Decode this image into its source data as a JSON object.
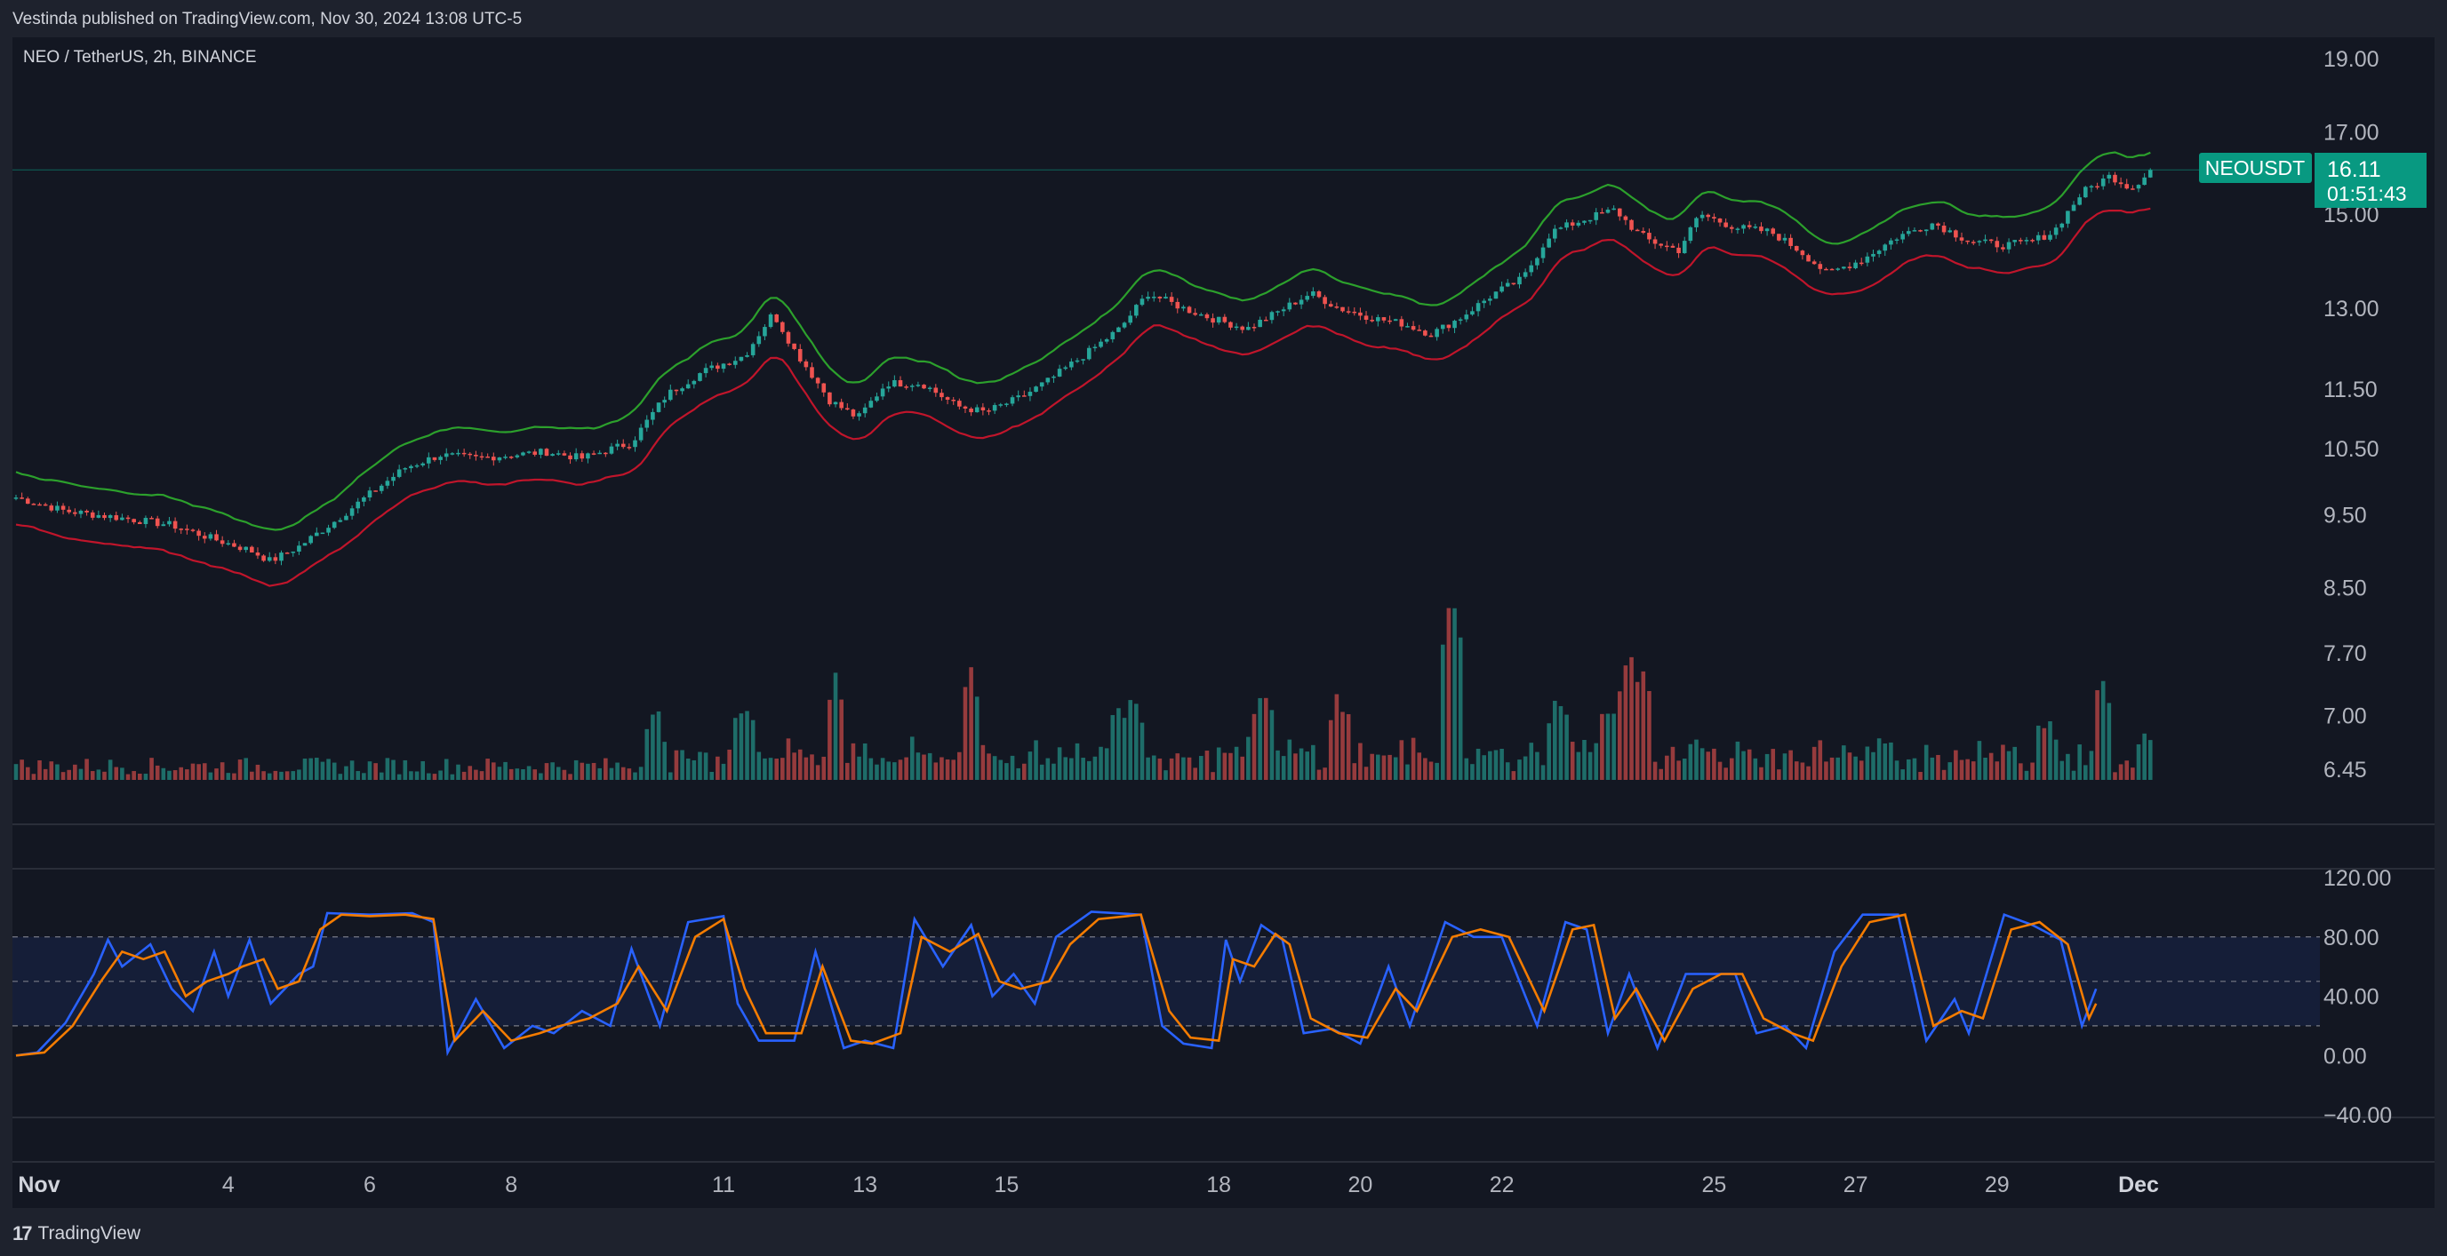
{
  "header": {
    "published": "Vestinda published on TradingView.com, Nov 30, 2024 13:08 UTC-5",
    "symbol_info": "NEO / TetherUS, 2h, BINANCE"
  },
  "footer": {
    "brand": "TradingView",
    "logo": "17"
  },
  "colors": {
    "background": "#131722",
    "bull": "#26a69a",
    "bear": "#ef5350",
    "upper_band": "#2ca02c",
    "lower_band": "#c0152b",
    "stoch_k": "#2962ff",
    "stoch_d": "#f57c00",
    "price_tag": "#089981"
  },
  "chart_data": [
    {
      "type": "candlestick",
      "series_name": "NEOUSDT",
      "y_scale": "log",
      "y_ticks": [
        "19.00",
        "17.00",
        "15.00",
        "13.00",
        "11.50",
        "10.50",
        "9.50",
        "8.50",
        "7.70",
        "7.00",
        "6.45"
      ],
      "last_price": "16.11",
      "countdown": "01:51:43",
      "x_ticks": [
        "Nov",
        "4",
        "6",
        "8",
        "11",
        "13",
        "15",
        "18",
        "20",
        "22",
        "25",
        "27",
        "29",
        "Dec"
      ],
      "x_tick_days": [
        1,
        4,
        6,
        8,
        11,
        13,
        15,
        18,
        20,
        22,
        25,
        27,
        29,
        31
      ],
      "close_path": [
        [
          1.0,
          9.75
        ],
        [
          1.7,
          9.55
        ],
        [
          2.5,
          9.45
        ],
        [
          3.2,
          9.35
        ],
        [
          3.8,
          9.15
        ],
        [
          4.3,
          9.0
        ],
        [
          4.6,
          8.85
        ],
        [
          5.0,
          9.05
        ],
        [
          5.5,
          9.4
        ],
        [
          6.0,
          9.8
        ],
        [
          6.5,
          10.2
        ],
        [
          7.0,
          10.4
        ],
        [
          7.5,
          10.35
        ],
        [
          8.0,
          10.4
        ],
        [
          8.5,
          10.45
        ],
        [
          9.0,
          10.35
        ],
        [
          9.7,
          10.6
        ],
        [
          10.2,
          11.4
        ],
        [
          10.7,
          11.8
        ],
        [
          11.3,
          12.1
        ],
        [
          11.7,
          12.9
        ],
        [
          12.0,
          12.2
        ],
        [
          12.5,
          11.3
        ],
        [
          12.9,
          11.0
        ],
        [
          13.3,
          11.6
        ],
        [
          13.8,
          11.6
        ],
        [
          14.3,
          11.2
        ],
        [
          14.7,
          11.1
        ],
        [
          15.2,
          11.35
        ],
        [
          15.6,
          11.65
        ],
        [
          16.2,
          12.2
        ],
        [
          16.6,
          12.6
        ],
        [
          17.0,
          13.3
        ],
        [
          17.5,
          13.0
        ],
        [
          17.9,
          12.8
        ],
        [
          18.4,
          12.6
        ],
        [
          18.8,
          12.9
        ],
        [
          19.3,
          13.3
        ],
        [
          19.7,
          13.0
        ],
        [
          20.2,
          12.8
        ],
        [
          20.6,
          12.7
        ],
        [
          21.0,
          12.5
        ],
        [
          21.4,
          12.8
        ],
        [
          21.9,
          13.3
        ],
        [
          22.3,
          13.6
        ],
        [
          22.7,
          14.6
        ],
        [
          23.2,
          14.9
        ],
        [
          23.6,
          15.1
        ],
        [
          23.9,
          14.6
        ],
        [
          24.1,
          14.4
        ],
        [
          24.5,
          14.2
        ],
        [
          24.8,
          15.0
        ],
        [
          25.3,
          14.7
        ],
        [
          25.8,
          14.6
        ],
        [
          26.2,
          14.2
        ],
        [
          26.6,
          13.7
        ],
        [
          27.1,
          14.0
        ],
        [
          27.6,
          14.5
        ],
        [
          28.1,
          14.8
        ],
        [
          28.6,
          14.4
        ],
        [
          29.1,
          14.3
        ],
        [
          29.5,
          14.4
        ],
        [
          29.8,
          14.6
        ],
        [
          30.2,
          15.5
        ],
        [
          30.6,
          15.9
        ],
        [
          30.9,
          15.6
        ],
        [
          31.2,
          16.1
        ]
      ]
    },
    {
      "type": "bar",
      "series_name": "Volume",
      "note_values": "relative volume spikes by day",
      "spikes": [
        [
          10.0,
          0.35
        ],
        [
          11.3,
          0.38
        ],
        [
          12.6,
          0.5
        ],
        [
          14.5,
          0.55
        ],
        [
          16.6,
          0.4
        ],
        [
          16.8,
          0.42
        ],
        [
          18.6,
          0.45
        ],
        [
          19.7,
          0.4
        ],
        [
          21.3,
          1.0
        ],
        [
          22.8,
          0.43
        ],
        [
          23.5,
          0.32
        ],
        [
          23.8,
          0.6
        ],
        [
          24.0,
          0.55
        ],
        [
          29.7,
          0.3
        ],
        [
          30.5,
          0.53
        ],
        [
          31.1,
          0.26
        ]
      ]
    },
    {
      "type": "line",
      "series_name": "Stochastic",
      "y_ticks": [
        "120.00",
        "80.00",
        "40.00",
        "0.00",
        "−40.00"
      ],
      "y_range": [
        -40,
        120
      ],
      "band": [
        20,
        80
      ],
      "k_path": [
        [
          1.0,
          0
        ],
        [
          1.3,
          2
        ],
        [
          1.7,
          22
        ],
        [
          2.1,
          55
        ],
        [
          2.3,
          78
        ],
        [
          2.5,
          60
        ],
        [
          2.9,
          75
        ],
        [
          3.2,
          45
        ],
        [
          3.5,
          30
        ],
        [
          3.8,
          70
        ],
        [
          4.0,
          40
        ],
        [
          4.3,
          78
        ],
        [
          4.6,
          35
        ],
        [
          5.0,
          55
        ],
        [
          5.2,
          60
        ],
        [
          5.4,
          96
        ],
        [
          6.0,
          95
        ],
        [
          6.6,
          96
        ],
        [
          6.9,
          90
        ],
        [
          7.1,
          2
        ],
        [
          7.5,
          38
        ],
        [
          7.9,
          5
        ],
        [
          8.3,
          20
        ],
        [
          8.6,
          15
        ],
        [
          9.0,
          30
        ],
        [
          9.4,
          20
        ],
        [
          9.7,
          72
        ],
        [
          10.1,
          20
        ],
        [
          10.5,
          90
        ],
        [
          11.0,
          94
        ],
        [
          11.2,
          35
        ],
        [
          11.5,
          10
        ],
        [
          12.0,
          10
        ],
        [
          12.3,
          70
        ],
        [
          12.7,
          5
        ],
        [
          13.0,
          10
        ],
        [
          13.4,
          5
        ],
        [
          13.7,
          92
        ],
        [
          14.1,
          60
        ],
        [
          14.5,
          88
        ],
        [
          14.8,
          40
        ],
        [
          15.1,
          55
        ],
        [
          15.4,
          35
        ],
        [
          15.7,
          80
        ],
        [
          16.2,
          97
        ],
        [
          16.9,
          95
        ],
        [
          17.2,
          20
        ],
        [
          17.5,
          8
        ],
        [
          17.9,
          5
        ],
        [
          18.1,
          78
        ],
        [
          18.3,
          50
        ],
        [
          18.6,
          88
        ],
        [
          18.9,
          78
        ],
        [
          19.2,
          15
        ],
        [
          19.6,
          18
        ],
        [
          20.0,
          8
        ],
        [
          20.4,
          60
        ],
        [
          20.7,
          20
        ],
        [
          21.2,
          90
        ],
        [
          21.6,
          80
        ],
        [
          22.0,
          80
        ],
        [
          22.5,
          20
        ],
        [
          22.9,
          90
        ],
        [
          23.2,
          85
        ],
        [
          23.5,
          15
        ],
        [
          23.8,
          55
        ],
        [
          24.2,
          5
        ],
        [
          24.6,
          55
        ],
        [
          25.0,
          55
        ],
        [
          25.3,
          55
        ],
        [
          25.6,
          15
        ],
        [
          26.0,
          20
        ],
        [
          26.3,
          5
        ],
        [
          26.7,
          70
        ],
        [
          27.1,
          95
        ],
        [
          27.6,
          95
        ],
        [
          28.0,
          10
        ],
        [
          28.4,
          38
        ],
        [
          28.6,
          15
        ],
        [
          29.1,
          95
        ],
        [
          29.5,
          88
        ],
        [
          29.9,
          78
        ],
        [
          30.2,
          20
        ],
        [
          30.4,
          45
        ]
      ],
      "d_path": [
        [
          1.0,
          0
        ],
        [
          1.4,
          2
        ],
        [
          1.8,
          20
        ],
        [
          2.2,
          50
        ],
        [
          2.5,
          70
        ],
        [
          2.8,
          65
        ],
        [
          3.1,
          70
        ],
        [
          3.4,
          40
        ],
        [
          3.7,
          50
        ],
        [
          4.0,
          55
        ],
        [
          4.2,
          60
        ],
        [
          4.5,
          65
        ],
        [
          4.7,
          45
        ],
        [
          5.0,
          50
        ],
        [
          5.3,
          85
        ],
        [
          5.6,
          95
        ],
        [
          6.0,
          94
        ],
        [
          6.5,
          95
        ],
        [
          6.9,
          92
        ],
        [
          7.2,
          10
        ],
        [
          7.6,
          30
        ],
        [
          8.0,
          10
        ],
        [
          8.4,
          15
        ],
        [
          8.7,
          20
        ],
        [
          9.1,
          25
        ],
        [
          9.5,
          35
        ],
        [
          9.8,
          60
        ],
        [
          10.2,
          30
        ],
        [
          10.6,
          80
        ],
        [
          11.0,
          92
        ],
        [
          11.3,
          45
        ],
        [
          11.6,
          15
        ],
        [
          12.1,
          15
        ],
        [
          12.4,
          60
        ],
        [
          12.8,
          10
        ],
        [
          13.1,
          8
        ],
        [
          13.5,
          15
        ],
        [
          13.8,
          80
        ],
        [
          14.2,
          70
        ],
        [
          14.6,
          82
        ],
        [
          14.9,
          50
        ],
        [
          15.2,
          45
        ],
        [
          15.6,
          50
        ],
        [
          15.9,
          75
        ],
        [
          16.3,
          92
        ],
        [
          16.9,
          95
        ],
        [
          17.3,
          30
        ],
        [
          17.6,
          12
        ],
        [
          18.0,
          10
        ],
        [
          18.2,
          65
        ],
        [
          18.5,
          60
        ],
        [
          18.8,
          82
        ],
        [
          19.0,
          75
        ],
        [
          19.3,
          25
        ],
        [
          19.7,
          15
        ],
        [
          20.1,
          12
        ],
        [
          20.5,
          45
        ],
        [
          20.8,
          30
        ],
        [
          21.3,
          80
        ],
        [
          21.7,
          85
        ],
        [
          22.1,
          80
        ],
        [
          22.6,
          30
        ],
        [
          23.0,
          85
        ],
        [
          23.3,
          88
        ],
        [
          23.6,
          25
        ],
        [
          23.9,
          45
        ],
        [
          24.3,
          10
        ],
        [
          24.7,
          45
        ],
        [
          25.1,
          55
        ],
        [
          25.4,
          55
        ],
        [
          25.7,
          25
        ],
        [
          26.1,
          15
        ],
        [
          26.4,
          10
        ],
        [
          26.8,
          60
        ],
        [
          27.2,
          90
        ],
        [
          27.7,
          95
        ],
        [
          28.1,
          20
        ],
        [
          28.5,
          30
        ],
        [
          28.8,
          25
        ],
        [
          29.2,
          85
        ],
        [
          29.6,
          90
        ],
        [
          30.0,
          75
        ],
        [
          30.3,
          25
        ],
        [
          30.4,
          35
        ]
      ]
    }
  ]
}
